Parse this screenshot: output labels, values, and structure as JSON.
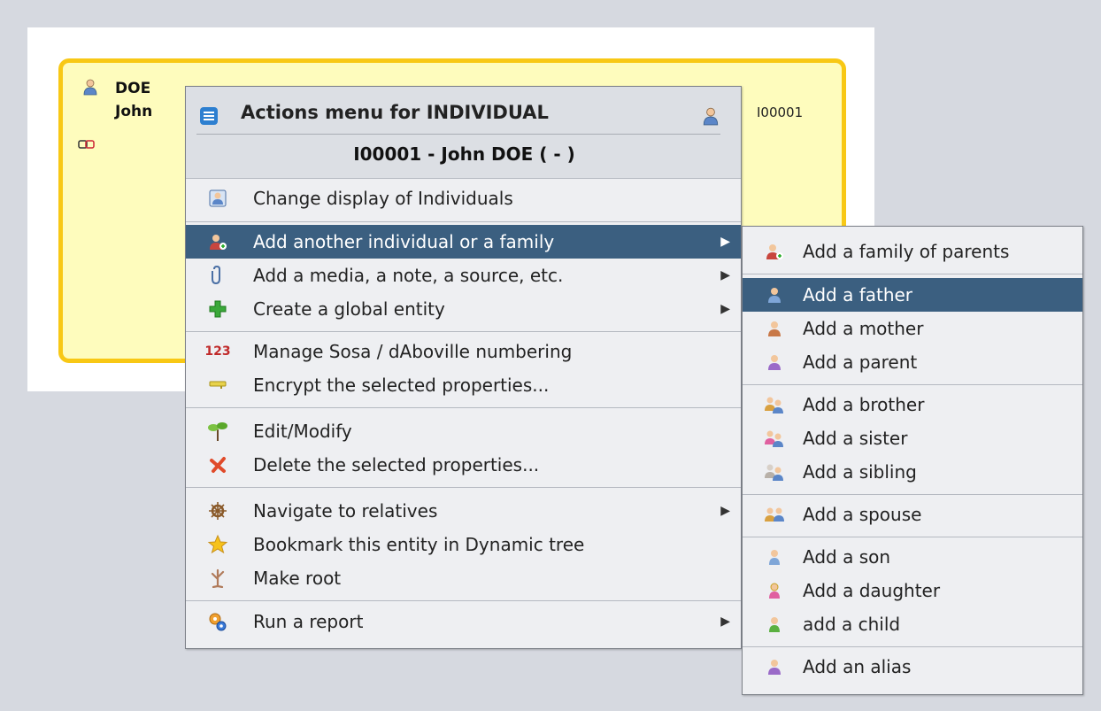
{
  "card": {
    "surname": "DOE",
    "given_name": "John",
    "id": "I00001",
    "icons": [
      "person-male-icon",
      "link-icon"
    ],
    "colors": {
      "fill": "#fefcbd",
      "border": "#f8c815"
    }
  },
  "menu": {
    "title": "Actions menu for INDIVIDUAL",
    "subtitle": "I00001 - John DOE ( - )",
    "selected_color": "#3b5f80",
    "items": [
      {
        "label": "Change display of Individuals",
        "icon": "display-individual-icon",
        "submenu": false
      },
      {
        "label": "Add another individual or a family",
        "icon": "add-individual-icon",
        "submenu": true,
        "selected": true
      },
      {
        "label": "Add a media, a note, a source, etc.",
        "icon": "paperclip-icon",
        "submenu": true
      },
      {
        "label": "Create a global entity",
        "icon": "plus-icon",
        "submenu": true
      },
      {
        "label": "Manage Sosa / dAboville numbering",
        "icon": "numbering-icon",
        "submenu": false
      },
      {
        "label": "Encrypt the selected properties...",
        "icon": "key-icon",
        "submenu": false
      },
      {
        "label": "Edit/Modify",
        "icon": "edit-icon",
        "submenu": false
      },
      {
        "label": "Delete the selected properties...",
        "icon": "delete-icon",
        "submenu": false
      },
      {
        "label": "Navigate to relatives",
        "icon": "navigate-wheel-icon",
        "submenu": true
      },
      {
        "label": "Bookmark this entity in Dynamic tree",
        "icon": "star-icon",
        "submenu": false
      },
      {
        "label": "Make root",
        "icon": "root-icon",
        "submenu": false
      },
      {
        "label": "Run a report",
        "icon": "report-gears-icon",
        "submenu": true
      }
    ],
    "numbering_glyph": "123"
  },
  "submenu": {
    "items": [
      {
        "label": "Add a family of parents",
        "icon": "family-parents-icon"
      },
      {
        "label": "Add a father",
        "icon": "father-icon",
        "selected": true
      },
      {
        "label": "Add a mother",
        "icon": "mother-icon"
      },
      {
        "label": "Add a parent",
        "icon": "parent-icon"
      },
      {
        "label": "Add a brother",
        "icon": "brother-icon"
      },
      {
        "label": "Add a sister",
        "icon": "sister-icon"
      },
      {
        "label": "Add a sibling",
        "icon": "sibling-icon"
      },
      {
        "label": "Add a spouse",
        "icon": "spouse-icon"
      },
      {
        "label": "Add a son",
        "icon": "son-icon"
      },
      {
        "label": "Add a daughter",
        "icon": "daughter-icon"
      },
      {
        "label": "add a child",
        "icon": "child-icon"
      },
      {
        "label": "Add an alias",
        "icon": "alias-icon"
      }
    ]
  },
  "arrow_glyph": "▶"
}
